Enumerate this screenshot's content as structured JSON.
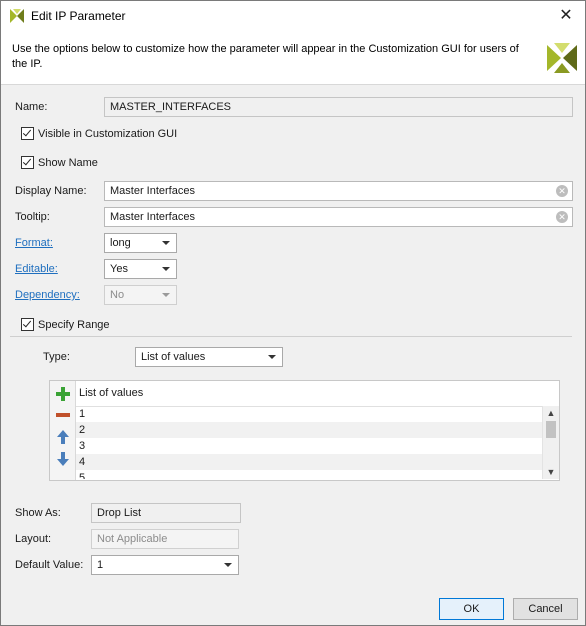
{
  "window": {
    "title": "Edit IP Parameter",
    "close_glyph": "✕"
  },
  "banner": {
    "description": "Use the options below to customize how the parameter will appear in the Customization GUI for users of the IP."
  },
  "form": {
    "name_label": "Name:",
    "name_value": "MASTER_INTERFACES",
    "visible_label": "Visible in Customization GUI",
    "visible_checked": true,
    "show_name_label": "Show Name",
    "show_name_checked": true,
    "display_name_label": "Display Name:",
    "display_name_value": "Master Interfaces",
    "tooltip_label": "Tooltip:",
    "tooltip_value": "Master Interfaces",
    "format_label": "Format:",
    "format_value": "long",
    "editable_label": "Editable:",
    "editable_value": "Yes",
    "dependency_label": "Dependency:",
    "dependency_value": "No",
    "specify_range_label": "Specify Range",
    "specify_range_checked": true,
    "type_label": "Type:",
    "type_value": "List of values"
  },
  "values_list": {
    "header": "List of values",
    "rows": [
      "1",
      "2",
      "3",
      "4",
      "5"
    ]
  },
  "bottom": {
    "show_as_label": "Show As:",
    "show_as_value": "Drop List",
    "layout_label": "Layout:",
    "layout_value": "Not Applicable",
    "default_label": "Default Value:",
    "default_value": "1"
  },
  "buttons": {
    "ok": "OK",
    "cancel": "Cancel"
  },
  "colors": {
    "link": "#1f6fbf",
    "add_icon": "#3aa335",
    "remove_icon": "#c0502a",
    "move_icon": "#4a7ebb",
    "logo": "#a4b72a"
  }
}
